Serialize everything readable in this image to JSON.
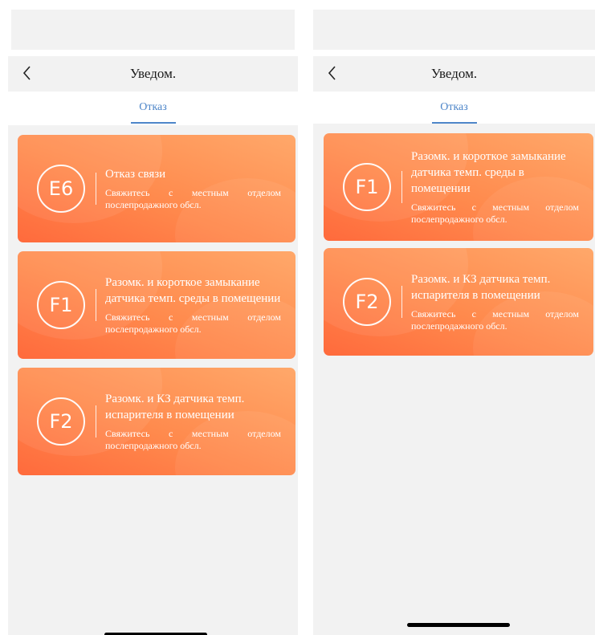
{
  "screens": [
    {
      "nav_title": "Уведом.",
      "tab_label": "Отказ",
      "cards": [
        {
          "code": "E6",
          "title": "Отказ связи",
          "description": "Свяжитесь с местным отделом послепродажного обсл."
        },
        {
          "code": "F1",
          "title": "Разомк. и короткое замыкание датчика темп. среды в помещении",
          "description": "Свяжитесь с местным отделом послепродажного обсл."
        },
        {
          "code": "F2",
          "title": "Разомк. и КЗ датчика темп. испарителя в помещении",
          "description": "Свяжитесь с местным отделом послепродажного обсл."
        }
      ]
    },
    {
      "nav_title": "Уведом.",
      "tab_label": "Отказ",
      "cards": [
        {
          "code": "F1",
          "title": "Разомк. и короткое замыкание датчика темп. среды в помещении",
          "description": "Свяжитесь с местным отделом послепродажного обсл."
        },
        {
          "code": "F2",
          "title": "Разомк. и КЗ датчика темп. испарителя в помещении",
          "description": "Свяжитесь с местным отделом послепродажного обсл."
        }
      ]
    }
  ],
  "colors": {
    "card_gradient_start": "#ff6a3c",
    "card_gradient_end": "#ffa86a",
    "tab_accent": "#4e86c9",
    "background": "#f2f2f2"
  },
  "icons": {
    "back": "chevron-left-icon"
  }
}
